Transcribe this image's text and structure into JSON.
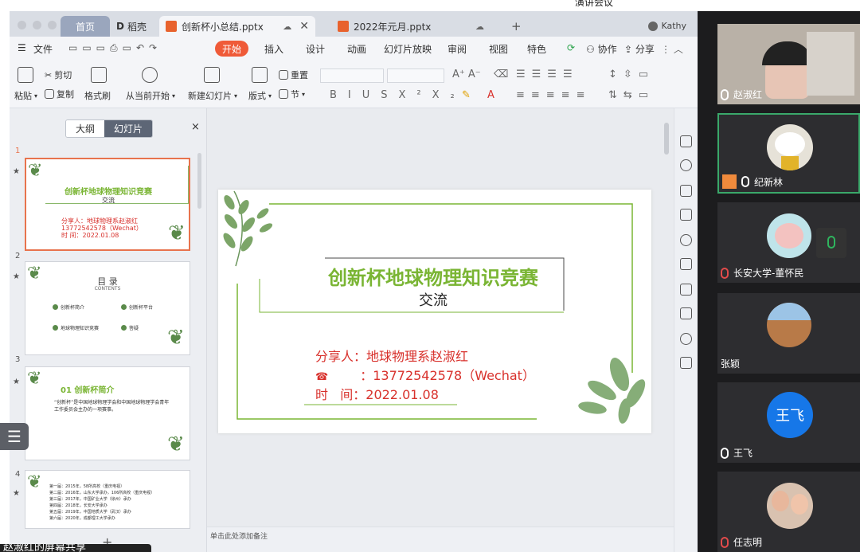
{
  "window_top_label": "演讲会议",
  "tabs": {
    "home": "首页",
    "daoke": "稻壳",
    "active_file": "创新杯小总结.pptx",
    "other_file": "2022年元月.pptx",
    "new_tab": "+"
  },
  "user_name": "Kathy",
  "menu": {
    "file": "文件",
    "start": "开始",
    "insert": "插入",
    "design": "设计",
    "animation": "动画",
    "slideshow": "幻灯片放映",
    "review": "审阅",
    "view": "视图",
    "special": "特色",
    "collab": "协作",
    "share": "分享"
  },
  "ribbon": {
    "paste": "粘贴",
    "cut": "剪切",
    "copy": "复制",
    "format_painter": "格式刷",
    "from_current": "从当前开始",
    "new_slide": "新建幻灯片",
    "layout": "版式",
    "reset": "重置",
    "section": "节"
  },
  "panel": {
    "outline_tab": "大纲",
    "slides_tab": "幻灯片",
    "close": "×",
    "add": "+"
  },
  "thumbs": [
    {
      "num": "1",
      "title": "创新杯地球物理知识竞赛",
      "sub": "交流",
      "l1": "分享人：地球物理系赵淑红",
      "l2": "13772542578（Wechat）",
      "l3": "时 间：2022.01.08"
    },
    {
      "num": "2",
      "title": "目 录",
      "sub": "CONTENTS",
      "items": [
        "创新杯简介",
        "创新杯平台",
        "地球物理知识竞赛",
        "答疑"
      ]
    },
    {
      "num": "3",
      "title": "01 创新杯简介",
      "body": "“创新杯”是中国地球物理学会和中国地球物理学会青年工作委员会主办的一项赛事。"
    },
    {
      "num": "4",
      "lines": [
        "第一届：2015年，58所高校（重庆电视）",
        "第二届：2016年，山东大学承办，106所高校（重庆电视）",
        "第三届：2017年，中国矿业大学（徐州）承办",
        "第四届：2018年，长安大学承办",
        "第五届：2019年，中国地质大学（武汉）承办",
        "第六届：2020年，成都理工大学承办"
      ]
    }
  ],
  "slide": {
    "title": "创新杯地球物理知识竞赛",
    "subtitle": "交流",
    "sharer_label": "分享人：",
    "sharer_value": "地球物理系赵淑红",
    "phone_icon": "☎",
    "phone_colon": "：",
    "phone_value": "13772542578（Wechat）",
    "date_label": "时   间：",
    "date_value": "2022.01.08"
  },
  "notes_placeholder": "单击此处添加备注",
  "float_icon": "☰",
  "share_status": "赵淑红的屏幕共享",
  "participants": [
    {
      "name": "赵淑红"
    },
    {
      "name": "纪新林"
    },
    {
      "name": "长安大学-董怀民"
    },
    {
      "name": "张颖"
    },
    {
      "name": "王飞",
      "avatar_text": "王飞"
    },
    {
      "name": "任志明"
    }
  ],
  "colors": {
    "accent_orange": "#ef5a38",
    "title_green": "#7ab534",
    "info_red": "#d8302b",
    "meeting_bg": "#1c1c1e",
    "avatar_blue": "#1677e8"
  }
}
